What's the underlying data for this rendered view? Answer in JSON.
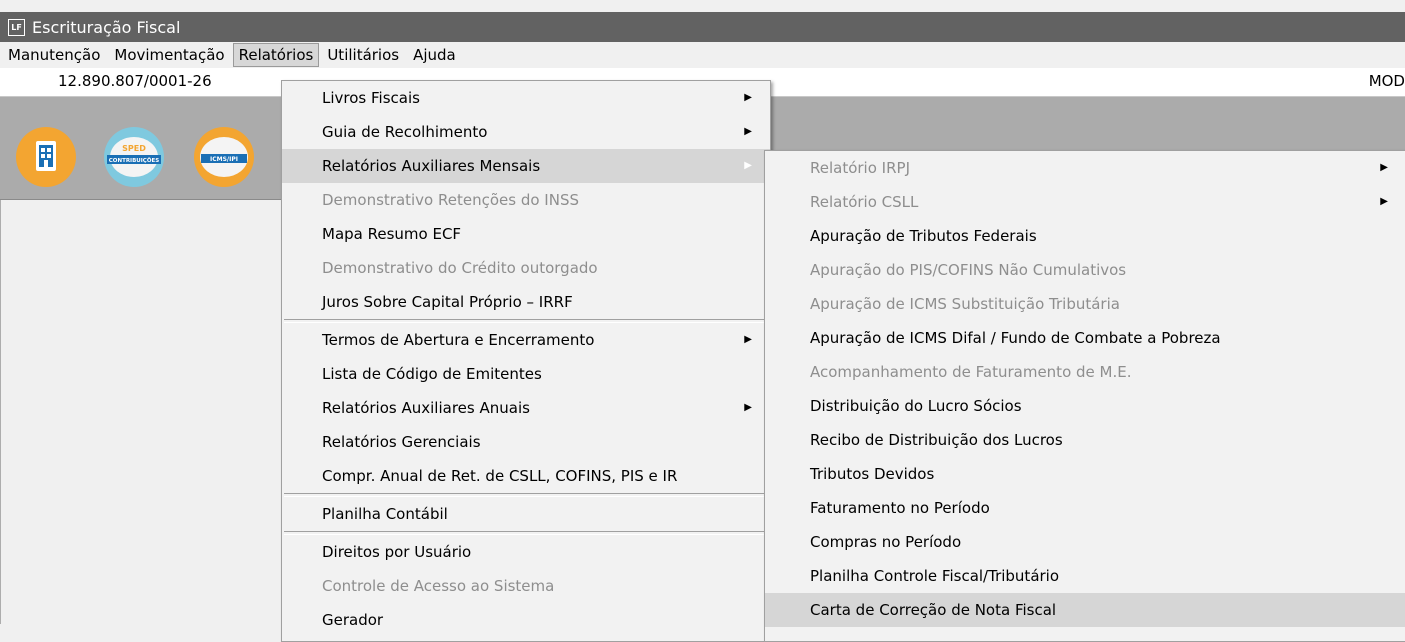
{
  "window": {
    "title": "Escrituração Fiscal",
    "icon_text": "LF"
  },
  "menubar": {
    "items": [
      {
        "label": "Manutenção"
      },
      {
        "label": "Movimentação"
      },
      {
        "label": "Relatórios"
      },
      {
        "label": "Utilitários"
      },
      {
        "label": "Ajuda"
      }
    ]
  },
  "infobar": {
    "cnpj": "12.890.807/0001-26",
    "mod": "MOD"
  },
  "toolbar": {
    "icons": [
      {
        "name": "company-icon"
      },
      {
        "name": "sped-contribuicoes-icon",
        "text_top": "SPED",
        "text_band": "CONTRIBUIÇÕES"
      },
      {
        "name": "icms-ipi-icon",
        "text_band": "ICMS/IPI"
      }
    ]
  },
  "relatorios_menu": {
    "items": [
      {
        "label": "Livros Fiscais",
        "submenu": true,
        "disabled": false
      },
      {
        "label": "Guia de Recolhimento",
        "submenu": true,
        "disabled": false
      },
      {
        "label": "Relatórios Auxiliares Mensais",
        "submenu": true,
        "disabled": false,
        "highlighted": true
      },
      {
        "label": "Demonstrativo Retenções do INSS",
        "submenu": false,
        "disabled": true
      },
      {
        "label": "Mapa Resumo ECF",
        "submenu": false,
        "disabled": false
      },
      {
        "label": "Demonstrativo do Crédito outorgado",
        "submenu": false,
        "disabled": true
      },
      {
        "label": "Juros Sobre Capital Próprio – IRRF",
        "submenu": false,
        "disabled": false
      },
      {
        "label": "Termos de Abertura e Encerramento",
        "submenu": true,
        "disabled": false
      },
      {
        "label": "Lista de Código de Emitentes",
        "submenu": false,
        "disabled": false
      },
      {
        "label": "Relatórios Auxiliares Anuais",
        "submenu": true,
        "disabled": false
      },
      {
        "label": "Relatórios Gerenciais",
        "submenu": false,
        "disabled": false
      },
      {
        "label": "Compr. Anual de Ret. de CSLL, COFINS,  PIS e IR",
        "submenu": false,
        "disabled": false
      },
      {
        "label": "Planilha Contábil",
        "submenu": false,
        "disabled": false
      },
      {
        "label": "Direitos por Usuário",
        "submenu": false,
        "disabled": false
      },
      {
        "label": "Controle de Acesso ao Sistema",
        "submenu": false,
        "disabled": true
      },
      {
        "label": "Gerador",
        "submenu": false,
        "disabled": false
      }
    ]
  },
  "auxiliares_mensais_menu": {
    "items": [
      {
        "label": "Relatório IRPJ",
        "submenu": true,
        "disabled": true
      },
      {
        "label": "Relatório CSLL",
        "submenu": true,
        "disabled": true
      },
      {
        "label": "Apuração de Tributos Federais",
        "submenu": false,
        "disabled": false
      },
      {
        "label": "Apuração do PIS/COFINS Não Cumulativos",
        "submenu": false,
        "disabled": true
      },
      {
        "label": "Apuração de ICMS Substituição Tributária",
        "submenu": false,
        "disabled": true
      },
      {
        "label": "Apuração de ICMS Difal / Fundo de Combate a Pobreza",
        "submenu": false,
        "disabled": false
      },
      {
        "label": "Acompanhamento de Faturamento de M.E.",
        "submenu": false,
        "disabled": true
      },
      {
        "label": "Distribuição do Lucro Sócios",
        "submenu": false,
        "disabled": false
      },
      {
        "label": "Recibo de Distribuição dos Lucros",
        "submenu": false,
        "disabled": false
      },
      {
        "label": "Tributos Devidos",
        "submenu": false,
        "disabled": false
      },
      {
        "label": "Faturamento no Período",
        "submenu": false,
        "disabled": false
      },
      {
        "label": "Compras no Período",
        "submenu": false,
        "disabled": false
      },
      {
        "label": "Planilha Controle Fiscal/Tributário",
        "submenu": false,
        "disabled": false
      },
      {
        "label": "Carta de Correção de Nota Fiscal",
        "submenu": false,
        "disabled": false,
        "highlighted": true
      }
    ]
  },
  "arrow_glyph": "▶"
}
